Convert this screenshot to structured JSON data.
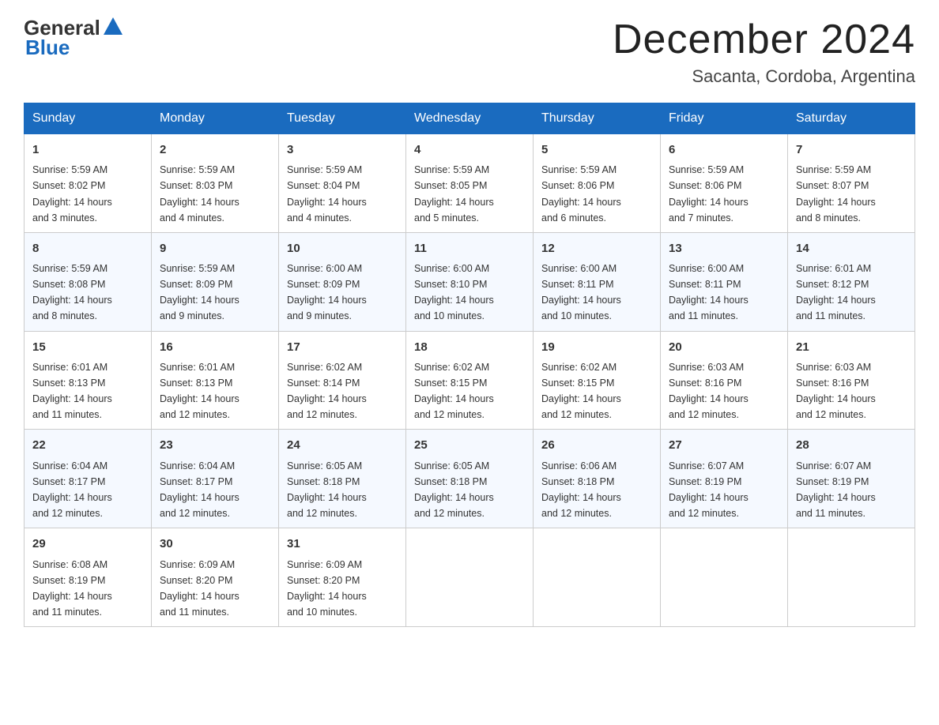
{
  "logo": {
    "text_general": "General",
    "text_blue": "Blue"
  },
  "calendar": {
    "title": "December 2024",
    "subtitle": "Sacanta, Cordoba, Argentina"
  },
  "headers": [
    "Sunday",
    "Monday",
    "Tuesday",
    "Wednesday",
    "Thursday",
    "Friday",
    "Saturday"
  ],
  "weeks": [
    [
      {
        "day": "1",
        "sunrise": "5:59 AM",
        "sunset": "8:02 PM",
        "daylight": "14 hours and 3 minutes."
      },
      {
        "day": "2",
        "sunrise": "5:59 AM",
        "sunset": "8:03 PM",
        "daylight": "14 hours and 4 minutes."
      },
      {
        "day": "3",
        "sunrise": "5:59 AM",
        "sunset": "8:04 PM",
        "daylight": "14 hours and 4 minutes."
      },
      {
        "day": "4",
        "sunrise": "5:59 AM",
        "sunset": "8:05 PM",
        "daylight": "14 hours and 5 minutes."
      },
      {
        "day": "5",
        "sunrise": "5:59 AM",
        "sunset": "8:06 PM",
        "daylight": "14 hours and 6 minutes."
      },
      {
        "day": "6",
        "sunrise": "5:59 AM",
        "sunset": "8:06 PM",
        "daylight": "14 hours and 7 minutes."
      },
      {
        "day": "7",
        "sunrise": "5:59 AM",
        "sunset": "8:07 PM",
        "daylight": "14 hours and 8 minutes."
      }
    ],
    [
      {
        "day": "8",
        "sunrise": "5:59 AM",
        "sunset": "8:08 PM",
        "daylight": "14 hours and 8 minutes."
      },
      {
        "day": "9",
        "sunrise": "5:59 AM",
        "sunset": "8:09 PM",
        "daylight": "14 hours and 9 minutes."
      },
      {
        "day": "10",
        "sunrise": "6:00 AM",
        "sunset": "8:09 PM",
        "daylight": "14 hours and 9 minutes."
      },
      {
        "day": "11",
        "sunrise": "6:00 AM",
        "sunset": "8:10 PM",
        "daylight": "14 hours and 10 minutes."
      },
      {
        "day": "12",
        "sunrise": "6:00 AM",
        "sunset": "8:11 PM",
        "daylight": "14 hours and 10 minutes."
      },
      {
        "day": "13",
        "sunrise": "6:00 AM",
        "sunset": "8:11 PM",
        "daylight": "14 hours and 11 minutes."
      },
      {
        "day": "14",
        "sunrise": "6:01 AM",
        "sunset": "8:12 PM",
        "daylight": "14 hours and 11 minutes."
      }
    ],
    [
      {
        "day": "15",
        "sunrise": "6:01 AM",
        "sunset": "8:13 PM",
        "daylight": "14 hours and 11 minutes."
      },
      {
        "day": "16",
        "sunrise": "6:01 AM",
        "sunset": "8:13 PM",
        "daylight": "14 hours and 12 minutes."
      },
      {
        "day": "17",
        "sunrise": "6:02 AM",
        "sunset": "8:14 PM",
        "daylight": "14 hours and 12 minutes."
      },
      {
        "day": "18",
        "sunrise": "6:02 AM",
        "sunset": "8:15 PM",
        "daylight": "14 hours and 12 minutes."
      },
      {
        "day": "19",
        "sunrise": "6:02 AM",
        "sunset": "8:15 PM",
        "daylight": "14 hours and 12 minutes."
      },
      {
        "day": "20",
        "sunrise": "6:03 AM",
        "sunset": "8:16 PM",
        "daylight": "14 hours and 12 minutes."
      },
      {
        "day": "21",
        "sunrise": "6:03 AM",
        "sunset": "8:16 PM",
        "daylight": "14 hours and 12 minutes."
      }
    ],
    [
      {
        "day": "22",
        "sunrise": "6:04 AM",
        "sunset": "8:17 PM",
        "daylight": "14 hours and 12 minutes."
      },
      {
        "day": "23",
        "sunrise": "6:04 AM",
        "sunset": "8:17 PM",
        "daylight": "14 hours and 12 minutes."
      },
      {
        "day": "24",
        "sunrise": "6:05 AM",
        "sunset": "8:18 PM",
        "daylight": "14 hours and 12 minutes."
      },
      {
        "day": "25",
        "sunrise": "6:05 AM",
        "sunset": "8:18 PM",
        "daylight": "14 hours and 12 minutes."
      },
      {
        "day": "26",
        "sunrise": "6:06 AM",
        "sunset": "8:18 PM",
        "daylight": "14 hours and 12 minutes."
      },
      {
        "day": "27",
        "sunrise": "6:07 AM",
        "sunset": "8:19 PM",
        "daylight": "14 hours and 12 minutes."
      },
      {
        "day": "28",
        "sunrise": "6:07 AM",
        "sunset": "8:19 PM",
        "daylight": "14 hours and 11 minutes."
      }
    ],
    [
      {
        "day": "29",
        "sunrise": "6:08 AM",
        "sunset": "8:19 PM",
        "daylight": "14 hours and 11 minutes."
      },
      {
        "day": "30",
        "sunrise": "6:09 AM",
        "sunset": "8:20 PM",
        "daylight": "14 hours and 11 minutes."
      },
      {
        "day": "31",
        "sunrise": "6:09 AM",
        "sunset": "8:20 PM",
        "daylight": "14 hours and 10 minutes."
      },
      null,
      null,
      null,
      null
    ]
  ],
  "labels": {
    "sunrise": "Sunrise:",
    "sunset": "Sunset:",
    "daylight": "Daylight:"
  }
}
